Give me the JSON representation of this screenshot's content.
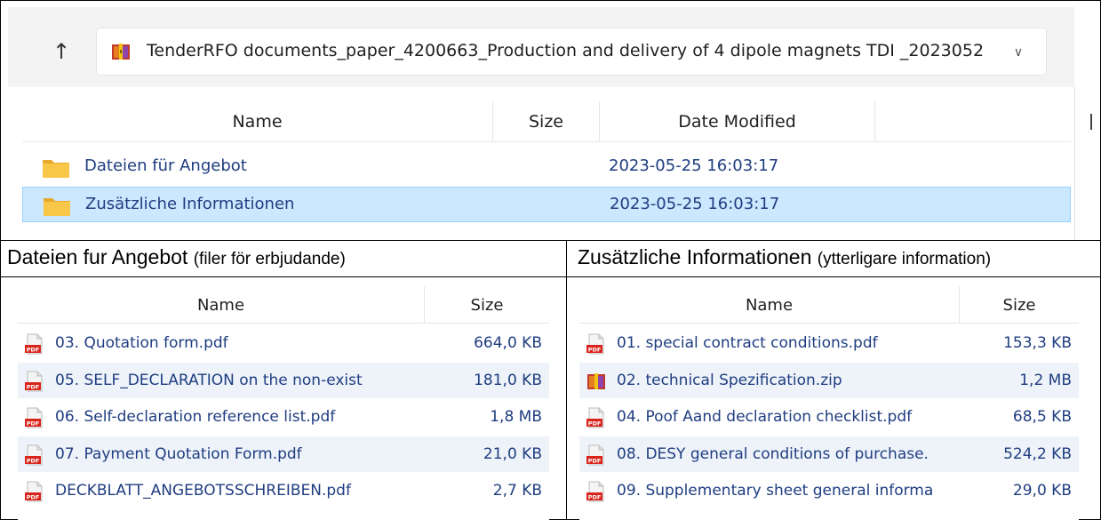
{
  "top": {
    "address_path": "TenderRFO documents_paper_4200663_Production and delivery of 4 dipole magnets TDI _2023052",
    "columns": {
      "name": "Name",
      "size": "Size",
      "date": "Date Modified"
    },
    "rows": [
      {
        "name": "Dateien für Angebot",
        "date": "2023-05-25 16:03:17"
      },
      {
        "name": "Zusätzliche Informationen",
        "date": "2023-05-25 16:03:17"
      }
    ]
  },
  "left_section": {
    "title": "Dateien fur Angebot",
    "subtitle": "(filer för erbjudande)",
    "columns": {
      "name": "Name",
      "size": "Size"
    },
    "files": [
      {
        "name": "03. Quotation form.pdf",
        "size": "664,0 KB",
        "icon": "pdf-icon"
      },
      {
        "name": "05. SELF_DECLARATION on the non-exist",
        "size": "181,0 KB",
        "icon": "pdf-icon"
      },
      {
        "name": "06. Self-declaration reference list.pdf",
        "size": "1,8 MB",
        "icon": "pdf-icon"
      },
      {
        "name": "07. Payment Quotation Form.pdf",
        "size": "21,0 KB",
        "icon": "pdf-icon"
      },
      {
        "name": "DECKBLATT_ANGEBOTSSCHREIBEN.pdf",
        "size": "2,7 KB",
        "icon": "pdf-icon"
      }
    ]
  },
  "right_section": {
    "title": "Zusätzliche Informationen",
    "subtitle": "(ytterligare information)",
    "columns": {
      "name": "Name",
      "size": "Size"
    },
    "files": [
      {
        "name": "01. special contract conditions.pdf",
        "size": "153,3 KB",
        "icon": "pdf-icon"
      },
      {
        "name": "02. technical Spezification.zip",
        "size": "1,2 MB",
        "icon": "zip-icon"
      },
      {
        "name": "04. Poof Aand declaration checklist.pdf",
        "size": "68,5 KB",
        "icon": "pdf-icon"
      },
      {
        "name": "08. DESY general conditions of purchase.",
        "size": "524,2 KB",
        "icon": "pdf-icon"
      },
      {
        "name": "09. Supplementary sheet general informa",
        "size": "29,0 KB",
        "icon": "pdf-icon"
      }
    ]
  },
  "colors": {
    "selection_bg": "#cce8ff",
    "selection_border": "#99d1ff",
    "link_text": "#1f3d80",
    "alt_row": "#eef3fa",
    "folder": "#f8c74a",
    "pdf_red": "#d9241c"
  }
}
